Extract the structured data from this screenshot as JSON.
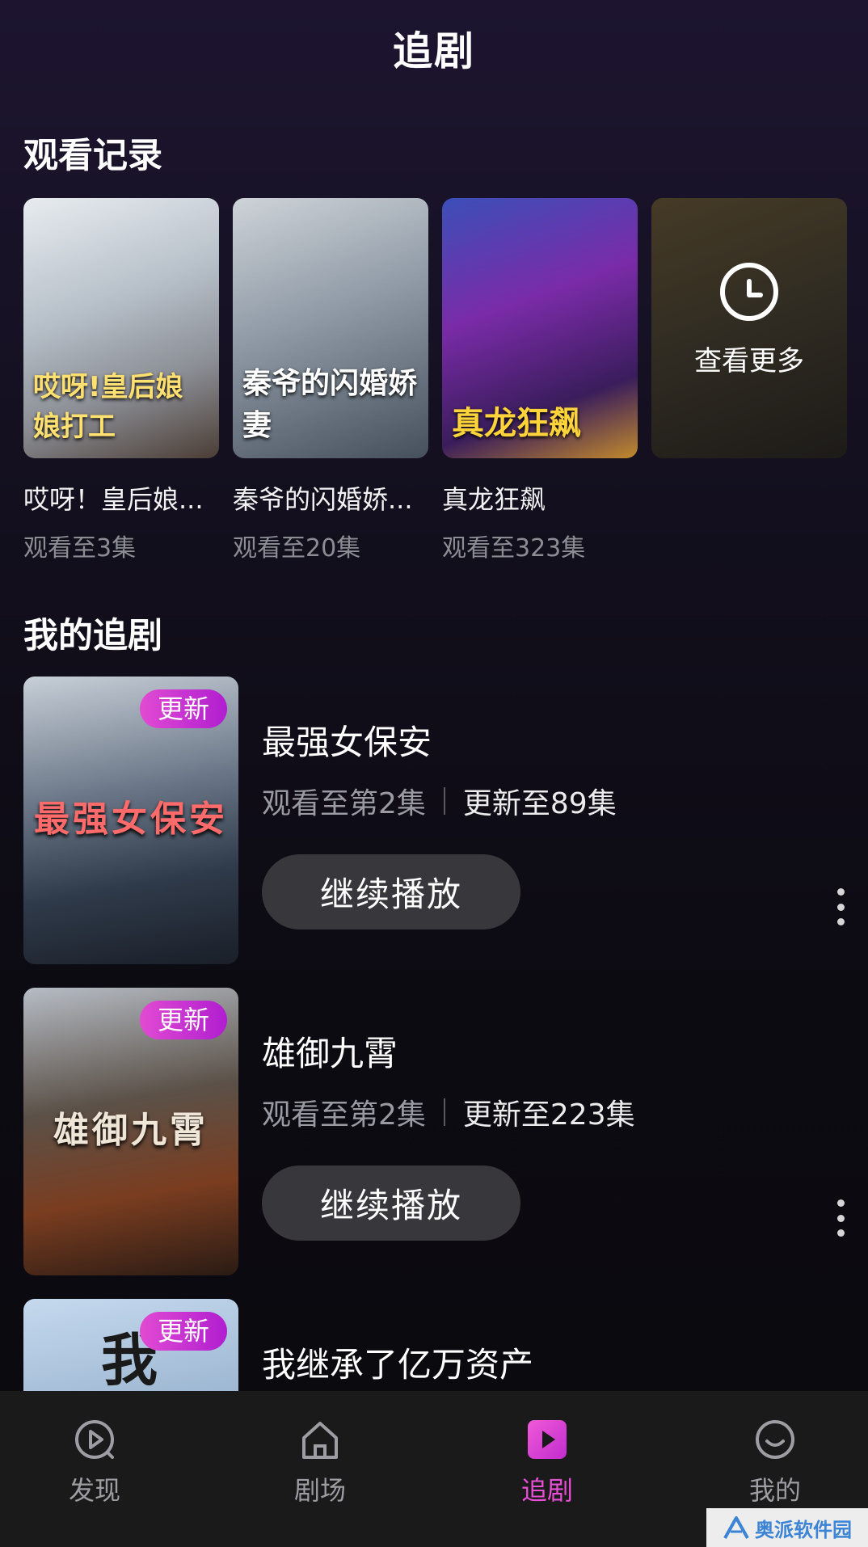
{
  "header": {
    "title": "追剧"
  },
  "watch_history": {
    "section_title": "观看记录",
    "items": [
      {
        "title": "哎呀！皇后娘...",
        "progress": "观看至3集",
        "poster_text": "哎呀!皇后娘娘打工"
      },
      {
        "title": "秦爷的闪婚娇...",
        "progress": "观看至20集",
        "poster_text": "秦爷的闪婚娇妻"
      },
      {
        "title": "真龙狂飙",
        "progress": "观看至323集",
        "poster_text": "真龙狂飙"
      }
    ],
    "more_label": "查看更多"
  },
  "my_follow": {
    "section_title": "我的追剧",
    "items": [
      {
        "title": "最强女保安",
        "watched": "观看至第2集",
        "updated": "更新至89集",
        "badge": "更新",
        "poster_text": "最强女保安",
        "button": "继续播放"
      },
      {
        "title": "雄御九霄",
        "watched": "观看至第2集",
        "updated": "更新至223集",
        "badge": "更新",
        "poster_text": "雄御九霄",
        "button": "继续播放"
      },
      {
        "title": "我继承了亿万资产",
        "badge": "更新",
        "poster_text": "我"
      }
    ]
  },
  "tabbar": {
    "tabs": [
      {
        "label": "发现",
        "icon": "discover-play-icon",
        "active": false
      },
      {
        "label": "剧场",
        "icon": "home-icon",
        "active": false
      },
      {
        "label": "追剧",
        "icon": "play-square-icon",
        "active": true
      },
      {
        "label": "我的",
        "icon": "smiley-face-icon",
        "active": false
      }
    ]
  },
  "watermark": {
    "text": "奥派软件园"
  },
  "colors": {
    "accent": "#e94fd6",
    "badge_start": "#e14bd2",
    "badge_end": "#b01ed0",
    "tab_bg": "#1a1a1a",
    "button_bg": "#38383c"
  }
}
